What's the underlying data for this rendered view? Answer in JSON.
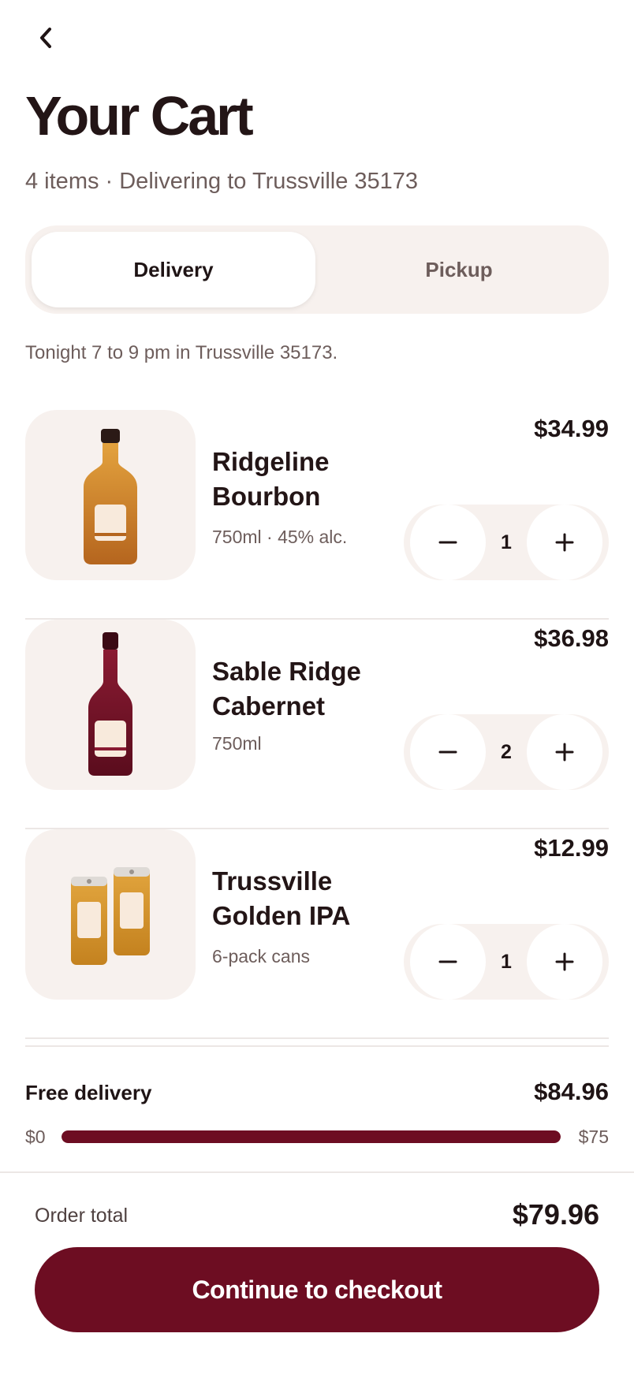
{
  "header": {
    "back_icon": "chevron-left-icon",
    "title": "Your Cart",
    "subtitle": "4 items · Delivering to Trussville 35173"
  },
  "fulfillment": {
    "options": [
      "Delivery",
      "Pickup"
    ],
    "selected": "Delivery",
    "window_text": "Tonight 7 to 9 pm in Trussville 35173."
  },
  "items": [
    {
      "name": "Ridgeline Bourbon",
      "meta": "750ml · 45% alc.",
      "price": "$34.99",
      "quantity": "1",
      "image_icon": "bourbon-bottle-icon"
    },
    {
      "name": "Sable Ridge Cabernet",
      "meta": "750ml",
      "price": "$36.98",
      "quantity": "2",
      "image_icon": "wine-bottle-icon"
    },
    {
      "name": "Trussville Golden IPA",
      "meta": "6-pack cans",
      "price": "$12.99",
      "quantity": "1",
      "image_icon": "beer-cans-icon"
    }
  ],
  "free_delivery": {
    "label": "Free delivery",
    "amount": "$84.96",
    "min_label": "$0",
    "max_label": "$75",
    "progress_fraction": 1.0
  },
  "footer": {
    "total_label": "Order total",
    "total_value": "$79.96",
    "checkout_label": "Continue to checkout"
  },
  "colors": {
    "accent": "#6d0d22",
    "text_primary": "#231516",
    "text_secondary": "#6d5d5b",
    "surface": "#f7f1ee"
  }
}
